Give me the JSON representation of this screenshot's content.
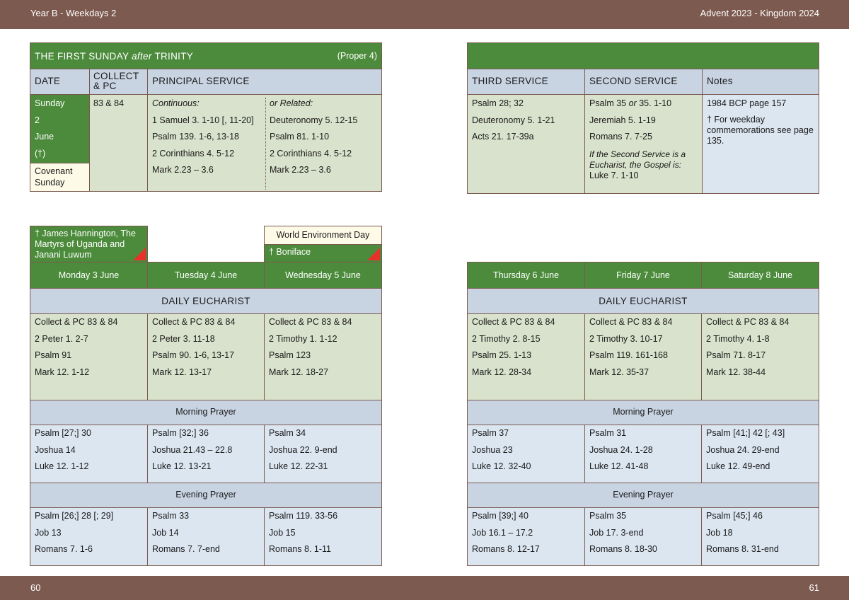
{
  "header": {
    "left": "Year B - Weekdays 2",
    "right": "Advent  2023 - Kingdom 2024"
  },
  "footer": {
    "left": "60",
    "right": "61"
  },
  "sunday": {
    "title_a": "THE FIRST SUNDAY ",
    "title_b": "after",
    "title_c": " TRINITY",
    "proper": "(Proper 4)",
    "col_date": "DATE",
    "col_collect": "COLLECT & PC",
    "col_principal": "PRINCIPAL SERVICE",
    "date_lines": [
      "Sunday",
      "2",
      "June",
      "(†)"
    ],
    "covenant": "Covenant Sunday",
    "collect": "83 & 84",
    "continuous": [
      "Continuous:",
      "1 Samuel 3. 1-10 [, 11-20]",
      "Psalm 139. 1-6, 13-18",
      "2 Corinthians 4. 5-12",
      "Mark 2.23 – 3.6"
    ],
    "related": [
      "or Related:",
      "Deuteronomy 5. 12-15",
      "Psalm 81. 1-10",
      "2 Corinthians 4. 5-12",
      "Mark 2.23 – 3.6"
    ],
    "col_third": "THIRD SERVICE",
    "col_second": "SECOND SERVICE",
    "col_notes": "Notes",
    "third": [
      "Psalm 28; 32",
      "Deuteronomy 5. 1-21",
      "Acts 21. 17-39a"
    ],
    "second_1": "Psalm 35 ",
    "second_or": "or",
    "second_2": " 35. 1-10",
    "second": [
      "Jeremiah 5. 1-19",
      "Romans 7. 7-25"
    ],
    "second_note": "If the Second Service is a Eucharist, the Gospel is:",
    "second_gospel": "Luke 7. 1-10",
    "notes_1": "1984 BCP page 157",
    "notes_2": "† For weekday commemorations see page 135."
  },
  "commemorations": {
    "monday": "† James Hannington, The Martyrs of Uganda and Janani Luwum",
    "wednesday_day": "World Environment Day",
    "wednesday": "† Boniface"
  },
  "labels": {
    "eucharist": "DAILY EUCHARIST",
    "morning": "Morning Prayer",
    "evening": "Evening Prayer"
  },
  "left_days": [
    {
      "name": "Monday 3 June",
      "eucharist": [
        "Collect & PC 83 & 84",
        "2 Peter 1. 2-7",
        "Psalm 91",
        "Mark 12. 1-12"
      ],
      "morning": [
        "Psalm [27;] 30",
        "Joshua 14",
        "Luke 12. 1-12"
      ],
      "evening": [
        "Psalm [26;] 28 [; 29]",
        "Job 13",
        "Romans 7. 1-6"
      ]
    },
    {
      "name": "Tuesday 4 June",
      "eucharist": [
        "Collect & PC 83 & 84",
        "2 Peter 3. 11-18",
        "Psalm 90. 1-6, 13-17",
        "Mark 12. 13-17"
      ],
      "morning": [
        "Psalm [32;] 36",
        "Joshua 21.43 – 22.8",
        "Luke 12. 13-21"
      ],
      "evening": [
        "Psalm 33",
        "Job 14",
        "Romans 7. 7-end"
      ]
    },
    {
      "name": "Wednesday 5 June",
      "eucharist": [
        "Collect & PC 83 & 84",
        "2 Timothy 1. 1-12",
        "Psalm 123",
        "Mark 12. 18-27"
      ],
      "morning": [
        "Psalm 34",
        "Joshua 22. 9-end",
        "Luke 12. 22-31"
      ],
      "evening": [
        "Psalm 119. 33-56",
        "Job 15",
        "Romans 8. 1-11"
      ]
    }
  ],
  "right_days": [
    {
      "name": "Thursday 6 June",
      "eucharist": [
        "Collect & PC 83 & 84",
        "2 Timothy 2. 8-15",
        "Psalm 25. 1-13",
        "Mark 12. 28-34"
      ],
      "morning": [
        "Psalm 37",
        "Joshua 23",
        "Luke 12. 32-40"
      ],
      "evening": [
        "Psalm [39;] 40",
        "Job 16.1 – 17.2",
        "Romans 8. 12-17"
      ]
    },
    {
      "name": "Friday 7 June",
      "eucharist": [
        "Collect & PC 83 & 84",
        "2 Timothy 3. 10-17",
        "Psalm 119. 161-168",
        "Mark 12. 35-37"
      ],
      "morning": [
        "Psalm 31",
        "Joshua 24. 1-28",
        "Luke 12. 41-48"
      ],
      "evening": [
        "Psalm 35",
        "Job 17. 3-end",
        "Romans 8. 18-30"
      ]
    },
    {
      "name": "Saturday 8 June",
      "eucharist": [
        "Collect & PC 83 & 84",
        "2 Timothy 4. 1-8",
        "Psalm 71. 8-17",
        "Mark 12. 38-44"
      ],
      "morning": [
        "Psalm [41;] 42 [; 43]",
        "Joshua 24. 29-end",
        "Luke 12. 49-end"
      ],
      "evening": [
        "Psalm [45;] 46",
        "Job 18",
        "Romans 8. 31-end"
      ]
    }
  ],
  "colors": {
    "bar": "#7d5a50",
    "green": "#4b8b3b",
    "header_blue": "#c9d4e3",
    "sage": "#d9e2cc",
    "light_blue": "#dce6f1",
    "cream": "#fdfbe7",
    "red_marker": "#e8312a"
  }
}
